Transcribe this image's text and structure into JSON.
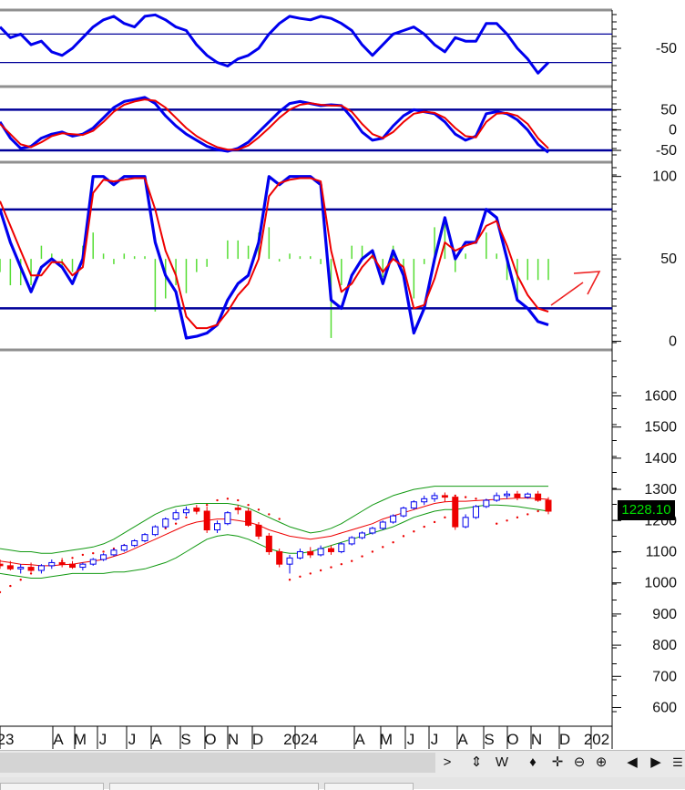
{
  "panels": {
    "osc1": {
      "ticks": [
        "-50"
      ],
      "ref_levels": [
        -30,
        -70
      ],
      "range": [
        -100,
        0
      ]
    },
    "osc2": {
      "ticks": [
        "50",
        "0",
        "-50"
      ],
      "ref_levels": [
        50,
        -50
      ],
      "range": [
        -70,
        100
      ]
    },
    "stoch": {
      "ticks": [
        "100",
        "50",
        "0"
      ],
      "ref_levels": [
        80,
        20
      ],
      "range": [
        -3,
        107
      ]
    },
    "price": {
      "ticks": [
        "1600",
        "1500",
        "1400",
        "1300",
        "1200",
        "1100",
        "1000",
        "900",
        "800",
        "700",
        "600"
      ],
      "range": [
        540,
        1730
      ]
    }
  },
  "last_price": "1228.10",
  "x_axis_labels": [
    "23",
    "A",
    "M",
    "J",
    "J",
    "A",
    "S",
    "O",
    "N",
    "D",
    "2024",
    "A",
    "M",
    "J",
    "J",
    "A",
    "S",
    "O",
    "N",
    "D",
    "202"
  ],
  "toolbar": {
    "nav_next": ">",
    "refresh": "⇕",
    "period": "W",
    "move": "♦",
    "crosshair": "✛",
    "zoom_out": "⊖",
    "zoom_in": "⊕",
    "prev": "◀",
    "next": "▶"
  },
  "colors": {
    "blue": "#0000ee",
    "red": "#ee0000",
    "histogram": "#55dd33",
    "bollinger": "#119911",
    "grid": "#000099"
  },
  "chart_data": [
    {
      "type": "line",
      "panel": "oscillator-1",
      "series": [
        {
          "values": [
            -20,
            -35,
            -30,
            -45,
            -40,
            -55,
            -60,
            -50,
            -35,
            -20,
            -10,
            -5,
            -15,
            -20,
            -5,
            -3,
            -10,
            -20,
            -25,
            -45,
            -60,
            -70,
            -75,
            -65,
            -60,
            -50,
            -30,
            -15,
            -5,
            -8,
            -10,
            -5,
            -8,
            -15,
            -25,
            -45,
            -60,
            -45,
            -30,
            -25,
            -20,
            -30,
            -45,
            -55,
            -35,
            -40,
            -40,
            -15,
            -15,
            -30,
            -50,
            -65,
            -85,
            -70
          ]
        }
      ],
      "ylim": [
        -100,
        0
      ]
    },
    {
      "type": "line",
      "panel": "oscillator-2",
      "series": [
        {
          "values": [
            20,
            -20,
            -45,
            -40,
            -20,
            -10,
            -5,
            -15,
            -10,
            5,
            30,
            55,
            70,
            75,
            80,
            65,
            35,
            10,
            -10,
            -25,
            -40,
            -48,
            -52,
            -45,
            -30,
            -5,
            20,
            45,
            65,
            70,
            65,
            60,
            62,
            60,
            30,
            -5,
            -25,
            -20,
            10,
            35,
            50,
            45,
            40,
            20,
            -10,
            -25,
            -15,
            40,
            45,
            40,
            25,
            0,
            -35,
            -55
          ]
        },
        {
          "values": [
            15,
            -10,
            -35,
            -42,
            -30,
            -15,
            -8,
            -10,
            -12,
            -2,
            20,
            45,
            62,
            70,
            75,
            72,
            55,
            30,
            5,
            -15,
            -30,
            -42,
            -48,
            -48,
            -38,
            -18,
            5,
            30,
            50,
            62,
            66,
            62,
            60,
            60,
            45,
            15,
            -10,
            -20,
            -5,
            20,
            40,
            45,
            42,
            30,
            5,
            -15,
            -18,
            20,
            40,
            42,
            35,
            15,
            -20,
            -45
          ]
        }
      ],
      "ylim": [
        -70,
        100
      ]
    },
    {
      "type": "line",
      "panel": "stochastic",
      "series": [
        {
          "values": [
            80,
            60,
            45,
            30,
            45,
            50,
            45,
            35,
            50,
            100,
            100,
            95,
            100,
            100,
            100,
            60,
            40,
            30,
            2,
            3,
            5,
            10,
            25,
            35,
            40,
            60,
            100,
            95,
            100,
            100,
            100,
            95,
            25,
            20,
            40,
            50,
            55,
            35,
            55,
            40,
            5,
            20,
            50,
            75,
            50,
            60,
            60,
            80,
            75,
            50,
            25,
            20,
            12,
            10
          ]
        },
        {
          "values": [
            85,
            70,
            55,
            40,
            40,
            48,
            48,
            40,
            45,
            90,
            98,
            97,
            98,
            99,
            99,
            80,
            55,
            40,
            15,
            8,
            8,
            10,
            18,
            28,
            35,
            50,
            88,
            96,
            98,
            99,
            99,
            97,
            55,
            30,
            35,
            45,
            52,
            42,
            50,
            45,
            20,
            22,
            38,
            60,
            55,
            58,
            60,
            70,
            73,
            58,
            40,
            28,
            20,
            18
          ]
        }
      ],
      "ylim": [
        0,
        100
      ],
      "levels": [
        80,
        20
      ],
      "annotation": "up-arrow"
    },
    {
      "type": "candlestick",
      "panel": "price",
      "ylim": [
        540,
        1730
      ],
      "ohlc": [
        [
          1060,
          1075,
          1045,
          1055
        ],
        [
          1055,
          1070,
          1040,
          1045
        ],
        [
          1045,
          1060,
          1030,
          1050
        ],
        [
          1050,
          1065,
          1035,
          1040
        ],
        [
          1040,
          1060,
          1030,
          1055
        ],
        [
          1055,
          1075,
          1045,
          1065
        ],
        [
          1065,
          1080,
          1050,
          1060
        ],
        [
          1060,
          1070,
          1045,
          1050
        ],
        [
          1050,
          1065,
          1040,
          1060
        ],
        [
          1060,
          1080,
          1055,
          1075
        ],
        [
          1075,
          1095,
          1070,
          1090
        ],
        [
          1090,
          1110,
          1085,
          1105
        ],
        [
          1105,
          1125,
          1100,
          1120
        ],
        [
          1120,
          1140,
          1115,
          1135
        ],
        [
          1135,
          1160,
          1130,
          1155
        ],
        [
          1155,
          1185,
          1150,
          1180
        ],
        [
          1180,
          1210,
          1175,
          1205
        ],
        [
          1205,
          1235,
          1200,
          1225
        ],
        [
          1225,
          1245,
          1215,
          1235
        ],
        [
          1240,
          1250,
          1220,
          1230
        ],
        [
          1230,
          1245,
          1160,
          1170
        ],
        [
          1170,
          1200,
          1160,
          1190
        ],
        [
          1190,
          1230,
          1185,
          1225
        ],
        [
          1240,
          1250,
          1220,
          1235
        ],
        [
          1230,
          1240,
          1180,
          1185
        ],
        [
          1185,
          1195,
          1140,
          1150
        ],
        [
          1150,
          1160,
          1090,
          1100
        ],
        [
          1100,
          1110,
          1050,
          1060
        ],
        [
          1060,
          1090,
          1030,
          1080
        ],
        [
          1080,
          1110,
          1075,
          1100
        ],
        [
          1100,
          1115,
          1080,
          1090
        ],
        [
          1090,
          1120,
          1085,
          1110
        ],
        [
          1110,
          1120,
          1090,
          1100
        ],
        [
          1100,
          1130,
          1095,
          1125
        ],
        [
          1125,
          1150,
          1120,
          1145
        ],
        [
          1145,
          1165,
          1140,
          1160
        ],
        [
          1160,
          1180,
          1155,
          1175
        ],
        [
          1175,
          1200,
          1170,
          1195
        ],
        [
          1195,
          1220,
          1190,
          1215
        ],
        [
          1215,
          1245,
          1210,
          1240
        ],
        [
          1240,
          1265,
          1235,
          1260
        ],
        [
          1260,
          1280,
          1250,
          1270
        ],
        [
          1270,
          1290,
          1260,
          1280
        ],
        [
          1280,
          1290,
          1260,
          1275
        ],
        [
          1275,
          1280,
          1170,
          1180
        ],
        [
          1180,
          1220,
          1175,
          1210
        ],
        [
          1210,
          1250,
          1205,
          1245
        ],
        [
          1245,
          1270,
          1240,
          1265
        ],
        [
          1265,
          1290,
          1260,
          1280
        ],
        [
          1280,
          1295,
          1270,
          1285
        ],
        [
          1285,
          1295,
          1265,
          1275
        ],
        [
          1275,
          1290,
          1270,
          1285
        ],
        [
          1285,
          1295,
          1260,
          1265
        ],
        [
          1265,
          1275,
          1220,
          1230
        ]
      ],
      "bollinger": {
        "upper": [
          1110,
          1105,
          1100,
          1100,
          1095,
          1095,
          1100,
          1105,
          1110,
          1115,
          1125,
          1140,
          1160,
          1180,
          1200,
          1220,
          1235,
          1245,
          1250,
          1255,
          1255,
          1255,
          1255,
          1250,
          1240,
          1225,
          1210,
          1195,
          1180,
          1170,
          1160,
          1165,
          1175,
          1190,
          1210,
          1230,
          1250,
          1265,
          1280,
          1290,
          1300,
          1305,
          1310,
          1310,
          1310,
          1310,
          1310,
          1310,
          1310,
          1310,
          1310,
          1310,
          1310,
          1310
        ],
        "mid": [
          1070,
          1065,
          1060,
          1058,
          1055,
          1055,
          1058,
          1060,
          1065,
          1070,
          1075,
          1085,
          1095,
          1110,
          1125,
          1140,
          1155,
          1170,
          1185,
          1195,
          1200,
          1205,
          1205,
          1200,
          1195,
          1185,
          1170,
          1160,
          1150,
          1145,
          1140,
          1145,
          1150,
          1160,
          1170,
          1180,
          1190,
          1205,
          1215,
          1225,
          1235,
          1245,
          1255,
          1260,
          1262,
          1262,
          1264,
          1266,
          1268,
          1270,
          1272,
          1272,
          1270,
          1268
        ],
        "lower": [
          1030,
          1025,
          1020,
          1015,
          1015,
          1020,
          1025,
          1030,
          1030,
          1030,
          1030,
          1035,
          1035,
          1040,
          1045,
          1055,
          1065,
          1080,
          1100,
          1120,
          1140,
          1150,
          1155,
          1150,
          1140,
          1125,
          1110,
          1100,
          1095,
          1095,
          1100,
          1110,
          1120,
          1130,
          1140,
          1150,
          1160,
          1170,
          1180,
          1195,
          1210,
          1220,
          1230,
          1235,
          1235,
          1240,
          1245,
          1250,
          1250,
          1248,
          1245,
          1240,
          1235,
          1230
        ]
      },
      "sar": [
        970,
        990,
        1010,
        1030,
        1045,
        1060,
        1070,
        1080,
        1090,
        1095,
        1100,
        1110,
        1120,
        1130,
        1145,
        1160,
        1175,
        1190,
        1210,
        1230,
        1250,
        1265,
        1270,
        1265,
        1250,
        1235,
        1220,
        1205,
        1010,
        1020,
        1030,
        1040,
        1050,
        1060,
        1070,
        1085,
        1100,
        1115,
        1130,
        1150,
        1165,
        1180,
        1195,
        1210,
        1280,
        1275,
        1270,
        1265,
        1190,
        1200,
        1210,
        1220,
        1230,
        1240
      ]
    }
  ]
}
